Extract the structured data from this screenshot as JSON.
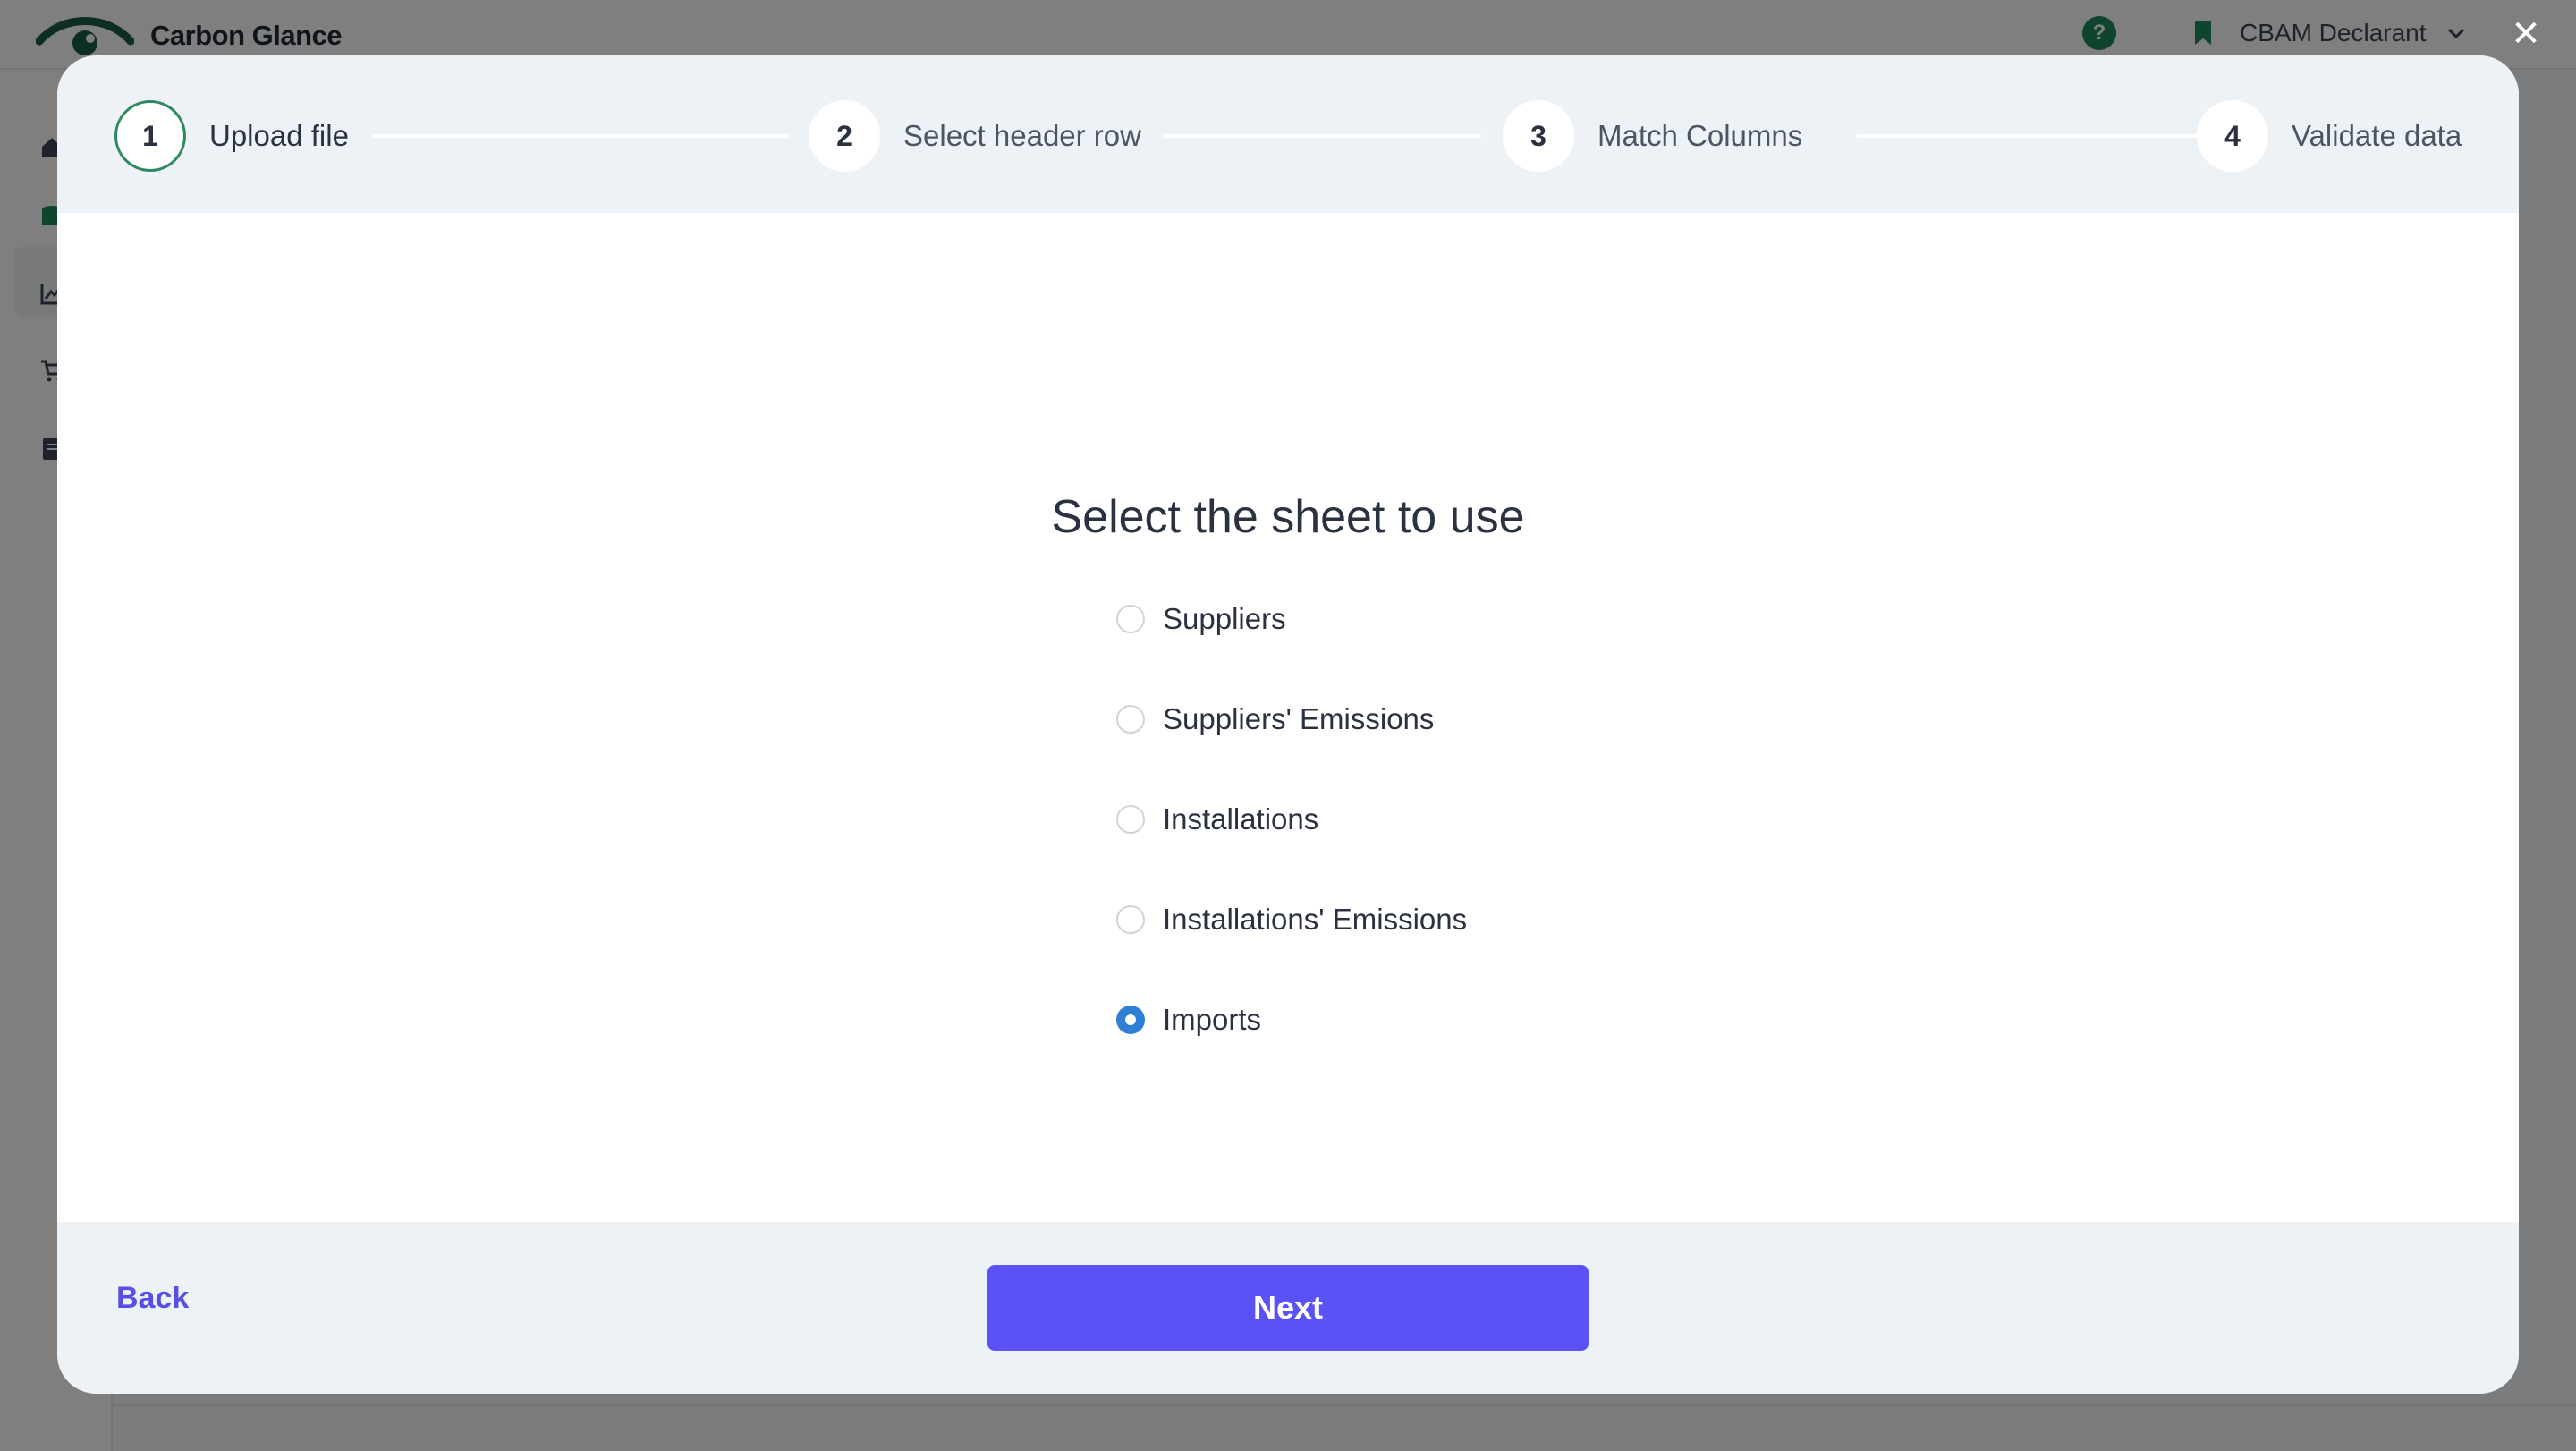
{
  "app": {
    "name": "Carbon Glance",
    "help_label": "?",
    "role": "CBAM Declarant",
    "close_glyph": "✕",
    "brand_color": "#1e8a5a"
  },
  "wizard": {
    "steps": [
      {
        "number": "1",
        "label": "Upload file",
        "active": true
      },
      {
        "number": "2",
        "label": "Select header row",
        "active": false
      },
      {
        "number": "3",
        "label": "Match Columns",
        "active": false
      },
      {
        "number": "4",
        "label": "Validate data",
        "active": false
      }
    ]
  },
  "sheet_picker": {
    "title": "Select the sheet to use",
    "options": [
      {
        "label": "Suppliers",
        "selected": false
      },
      {
        "label": "Suppliers' Emissions",
        "selected": false
      },
      {
        "label": "Installations",
        "selected": false
      },
      {
        "label": "Installations' Emissions",
        "selected": false
      },
      {
        "label": "Imports",
        "selected": true
      }
    ]
  },
  "footer": {
    "back_label": "Back",
    "next_label": "Next",
    "accent_color": "#5b52f5"
  }
}
